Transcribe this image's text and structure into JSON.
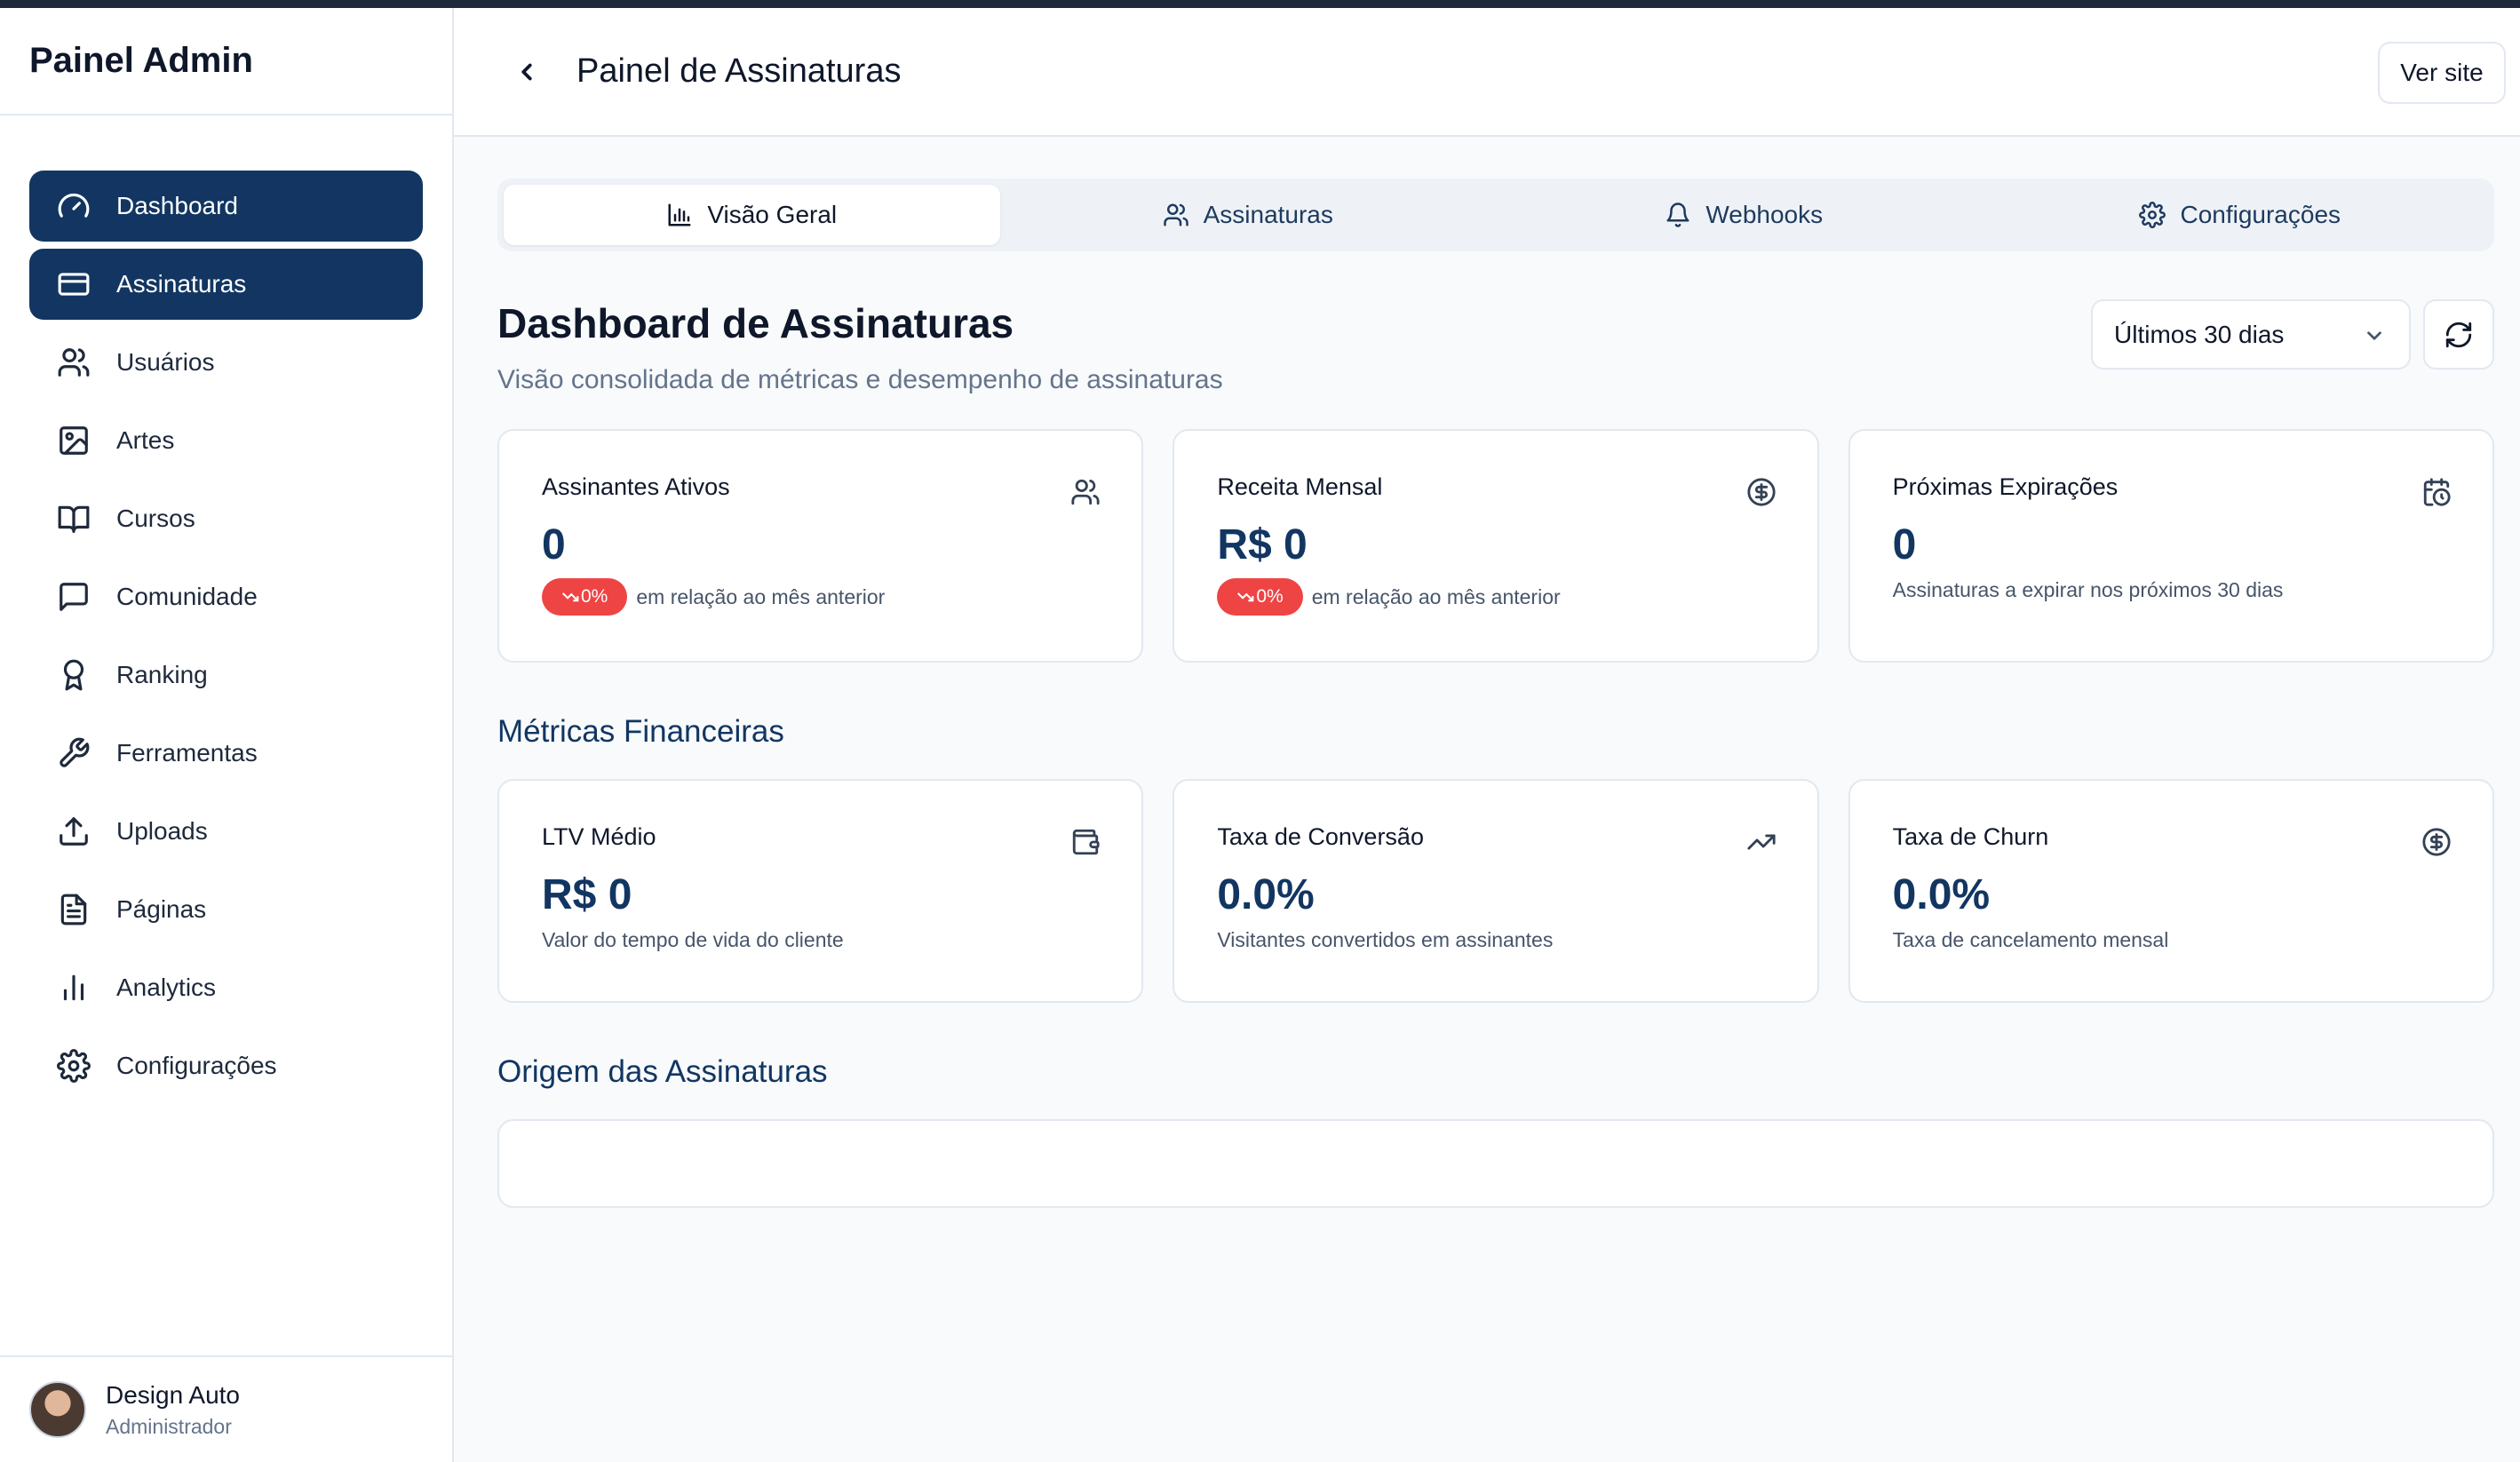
{
  "sidebar": {
    "brand": "Painel Admin",
    "items": [
      {
        "label": "Dashboard",
        "icon": "gauge-icon"
      },
      {
        "label": "Assinaturas",
        "icon": "credit-card-icon"
      },
      {
        "label": "Usuários",
        "icon": "users-icon"
      },
      {
        "label": "Artes",
        "icon": "image-icon"
      },
      {
        "label": "Cursos",
        "icon": "book-open-icon"
      },
      {
        "label": "Comunidade",
        "icon": "message-square-icon"
      },
      {
        "label": "Ranking",
        "icon": "award-icon"
      },
      {
        "label": "Ferramentas",
        "icon": "wrench-icon"
      },
      {
        "label": "Uploads",
        "icon": "upload-icon"
      },
      {
        "label": "Páginas",
        "icon": "file-text-icon"
      },
      {
        "label": "Analytics",
        "icon": "bar-chart-icon"
      },
      {
        "label": "Configurações",
        "icon": "gear-icon"
      }
    ],
    "user": {
      "name": "Design Auto",
      "role": "Administrador"
    }
  },
  "header": {
    "title": "Painel de Assinaturas",
    "ver_site": "Ver site"
  },
  "tabs": [
    {
      "label": "Visão Geral",
      "icon": "bar-chart-icon"
    },
    {
      "label": "Assinaturas",
      "icon": "users-icon"
    },
    {
      "label": "Webhooks",
      "icon": "bell-icon"
    },
    {
      "label": "Configurações",
      "icon": "gear-icon"
    }
  ],
  "dashboard": {
    "title": "Dashboard de Assinaturas",
    "subtitle": "Visão consolidada de métricas e desempenho de assinaturas",
    "period": "Últimos 30 dias"
  },
  "cards": [
    {
      "label": "Assinantes Ativos",
      "value": "0",
      "badge": "0%",
      "note": "em relação ao mês anterior",
      "icon": "users-icon"
    },
    {
      "label": "Receita Mensal",
      "value": "R$ 0",
      "badge": "0%",
      "note": "em relação ao mês anterior",
      "icon": "dollar-circle-icon"
    },
    {
      "label": "Próximas Expirações",
      "value": "0",
      "note": "Assinaturas a expirar nos próximos 30 dias",
      "icon": "calendar-clock-icon"
    }
  ],
  "financial": {
    "title": "Métricas Financeiras",
    "cards": [
      {
        "label": "LTV Médio",
        "value": "R$ 0",
        "note": "Valor do tempo de vida do cliente",
        "icon": "wallet-icon"
      },
      {
        "label": "Taxa de Conversão",
        "value": "0.0%",
        "note": "Visitantes convertidos em assinantes",
        "icon": "trending-up-icon"
      },
      {
        "label": "Taxa de Churn",
        "value": "0.0%",
        "note": "Taxa de cancelamento mensal",
        "icon": "dollar-circle-icon"
      }
    ]
  },
  "origin": {
    "title": "Origem das Assinaturas"
  },
  "colors": {
    "primary": "#123661",
    "danger": "#ef4444",
    "border": "#e2e8f0",
    "background": "#f8fafc"
  }
}
